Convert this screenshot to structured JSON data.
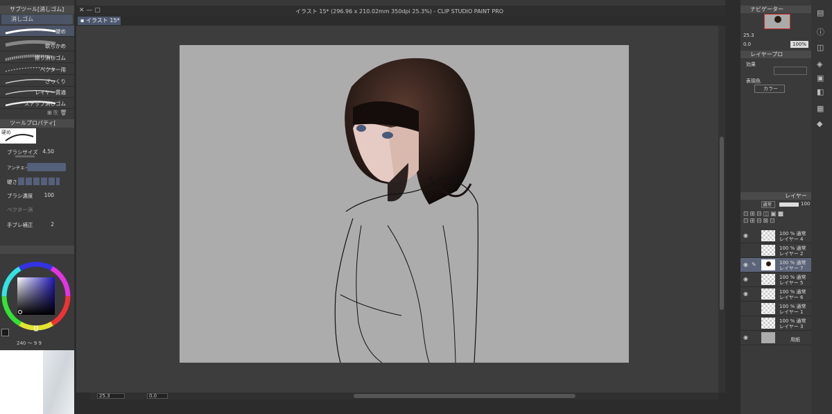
{
  "window": {
    "title": "イラスト 15* (296.96 x 210.02mm 350dpi 25.3%) - CLIP STUDIO PAINT PRO",
    "tab": "イラスト 15*"
  },
  "subtool": {
    "header": "サブツール[消しゴム]",
    "group": "消しゴム",
    "brushes": [
      "硬め",
      "軟らかめ",
      "擦り消しゴム",
      "ベクター用",
      "ざっくり",
      "レイヤー貫通",
      "スナップ消しゴム"
    ]
  },
  "toolprop": {
    "header": "ツールプロパティ[",
    "preview_label": "硬め",
    "brush_size_label": "ブラシサイズ",
    "brush_size": "4.50",
    "anti_label": "アンチエイ",
    "hardness_label": "硬さ",
    "density_label": "ブラシ濃度",
    "density": "100",
    "vector_label": "ベクター消",
    "stabil_label": "手ブレ補正",
    "stabil": "2"
  },
  "color": {
    "readout_a": "240",
    "readout_b": "9",
    "readout_c": "9",
    "main": "#1a1a1a",
    "sub": "#ffffff"
  },
  "statusbar": {
    "zoom": "25.3",
    "angle": "0.0"
  },
  "navigator": {
    "header": "ナビゲーター",
    "zoom": "25.3",
    "angle": "0.0",
    "percent": "100%"
  },
  "layerprop": {
    "header": "レイヤープロ",
    "effect_label": "効果",
    "expr_label": "表現色",
    "expr_value": "カラー"
  },
  "layers": {
    "header": "レイヤー",
    "blend": "通常",
    "opacity": "100",
    "items": [
      {
        "line1": "100 % 通常",
        "line2": "レイヤー 4"
      },
      {
        "line1": "100 % 通常",
        "line2": "レイヤー 2"
      },
      {
        "line1": "100 % 通常",
        "line2": "レイヤー 7"
      },
      {
        "line1": "100 % 通常",
        "line2": "レイヤー 5"
      },
      {
        "line1": "100 % 通常",
        "line2": "レイヤー 6"
      },
      {
        "line1": "100 % 通常",
        "line2": "レイヤー 1"
      },
      {
        "line1": "100 % 通常",
        "line2": "レイヤー 3"
      },
      {
        "line1": "",
        "line2": "用紙"
      }
    ]
  }
}
